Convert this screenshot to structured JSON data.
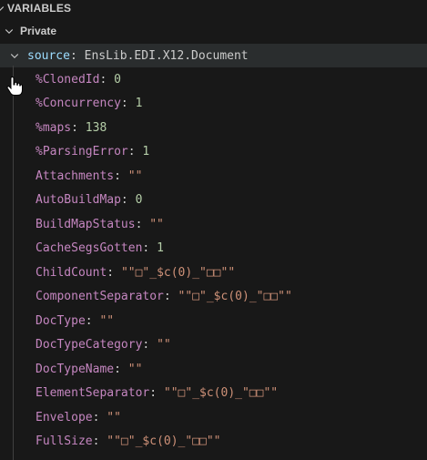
{
  "header": {
    "title": "VARIABLES"
  },
  "scope": {
    "label": "Private"
  },
  "source": {
    "name": "source",
    "separator": ":",
    "type": "EnsLib.EDI.X12.Document"
  },
  "rows": [
    {
      "name": "%ClonedId",
      "value": "0",
      "kind": "num"
    },
    {
      "name": "%Concurrency",
      "value": "1",
      "kind": "num"
    },
    {
      "name": "%maps",
      "value": "138",
      "kind": "num"
    },
    {
      "name": "%ParsingError",
      "value": "1",
      "kind": "num"
    },
    {
      "name": "Attachments",
      "value": "\"\"",
      "kind": "str"
    },
    {
      "name": "AutoBuildMap",
      "value": "0",
      "kind": "num"
    },
    {
      "name": "BuildMapStatus",
      "value": "\"\"",
      "kind": "str"
    },
    {
      "name": "CacheSegsGotten",
      "value": "1",
      "kind": "num"
    },
    {
      "name": "ChildCount",
      "value": "\"\"□\"_$c(0)_\"□□\"\"",
      "kind": "str"
    },
    {
      "name": "ComponentSeparator",
      "value": "\"\"□\"_$c(0)_\"□□\"\"",
      "kind": "str"
    },
    {
      "name": "DocType",
      "value": "\"\"",
      "kind": "str"
    },
    {
      "name": "DocTypeCategory",
      "value": "\"\"",
      "kind": "str"
    },
    {
      "name": "DocTypeName",
      "value": "\"\"",
      "kind": "str"
    },
    {
      "name": "ElementSeparator",
      "value": "\"\"□\"_$c(0)_\"□□\"\"",
      "kind": "str"
    },
    {
      "name": "Envelope",
      "value": "\"\"",
      "kind": "str"
    },
    {
      "name": "FullSize",
      "value": "\"\"□\"_$c(0)_\"□□\"\"",
      "kind": "str"
    }
  ],
  "icons": {
    "section_chevron": "chevron-down-icon",
    "scope_chevron": "chevron-down-icon",
    "source_chevron": "chevron-down-icon",
    "cursor": "hand-pointer-icon"
  },
  "colors": {
    "background": "#181818",
    "selected_row": "#2a2d2e",
    "name_private": "#c586c0",
    "name_source": "#9cdcfe",
    "number": "#b5cea8",
    "string": "#ce9178"
  }
}
